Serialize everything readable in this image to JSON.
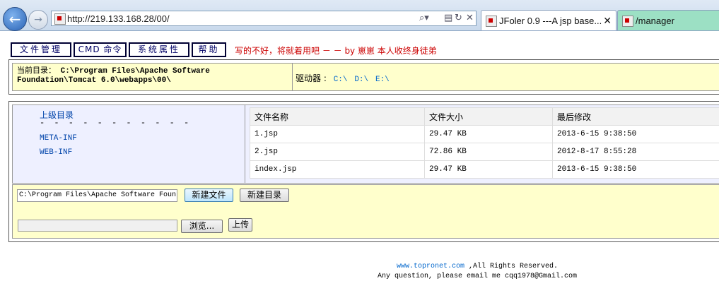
{
  "browser": {
    "url": "http://219.133.168.28/00/",
    "tabs": [
      {
        "label": "JFoler 0.9 ---A jsp base..."
      },
      {
        "label": "/manager"
      }
    ]
  },
  "menu": {
    "items": [
      {
        "label": "文件管理"
      },
      {
        "label": "CMD 命令"
      },
      {
        "label": "系统属性"
      },
      {
        "label": "帮助"
      }
    ],
    "notice": "写的不好，将就着用吧 － － by 崽崽 本人收终身徒弟"
  },
  "info": {
    "current_dir_label": "当前目录：",
    "current_dir_value": "C:\\Program Files\\Apache Software Foundation\\Tomcat 6.0\\webapps\\00\\",
    "drives_label": "驱动器 :",
    "drives": [
      "C:\\",
      "D:\\",
      "E:\\"
    ]
  },
  "tree": {
    "up_label": "上级目录",
    "dashes": "- - - - - - - - - - -",
    "dirs": [
      "META-INF",
      "WEB-INF"
    ]
  },
  "files": {
    "headers": [
      "文件名称",
      "文件大小",
      "最后修改"
    ],
    "rows": [
      {
        "name": "1.jsp",
        "size": "29.47 KB",
        "modified": "2013-6-15 9:38:50"
      },
      {
        "name": "2.jsp",
        "size": "72.86 KB",
        "modified": "2012-8-17 8:55:28"
      },
      {
        "name": "index.jsp",
        "size": "29.47 KB",
        "modified": "2013-6-15 9:38:50"
      }
    ]
  },
  "actions": {
    "path_value": "C:\\Program Files\\Apache Software Foun",
    "new_file": "新建文件",
    "new_dir": "新建目录",
    "browse": "浏览...",
    "upload": "上传"
  },
  "footer": {
    "site": "www.topronet.com",
    "rights": " ,All Rights Reserved.",
    "contact": "Any question, please email me cqq1978@Gmail.com"
  }
}
